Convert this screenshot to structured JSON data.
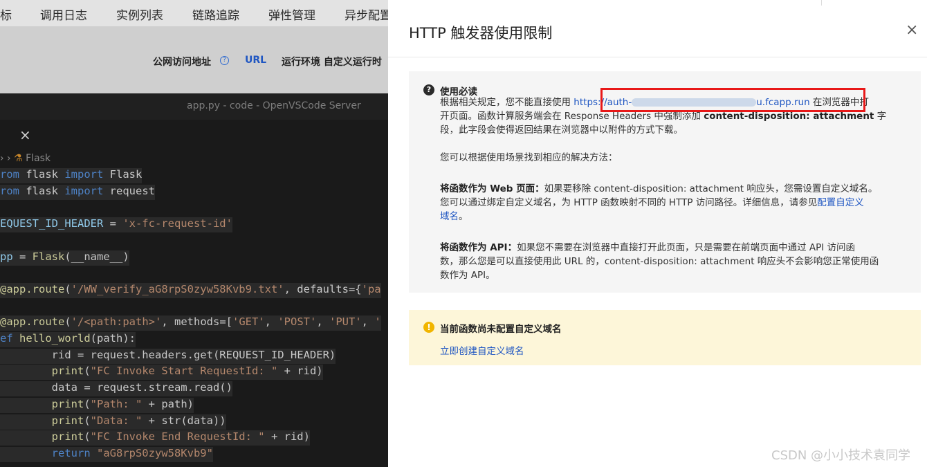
{
  "background": {
    "nav_tabs": [
      "标",
      "调用日志",
      "实例列表",
      "链路追踪",
      "弹性管理",
      "异步配置"
    ],
    "public_url_label": "公网访问地址",
    "help_icon": "?",
    "url_link": "URL",
    "runtime_label": "运行环境 自定义运行时",
    "editor_title": "app.py - code - OpenVSCode Server",
    "tab_close": "×",
    "breadcrumb_file": "Flask",
    "code_lines": [
      [
        "kw:rom ",
        "op:flask ",
        "kw:import ",
        "op:Flask"
      ],
      [
        "kw:rom ",
        "op:flask ",
        "kw:import ",
        "op:request"
      ],
      [],
      [
        "var:EQUEST_ID_HEADER ",
        "op:= ",
        "str:'x-fc-request-id'"
      ],
      [],
      [
        "var:pp ",
        "op:= ",
        "fn:Flask",
        "op:(__name__)"
      ],
      [],
      [
        "fn:@app.route",
        "op:(",
        "str:'/WW_verify_aG8rpS0zyw58Kvb9.txt'",
        "op:, defaults={",
        "str:'pa"
      ],
      [],
      [
        "fn:@app.route",
        "op:(",
        "str:'/<path:path>'",
        "op:, methods=[",
        "str:'GET'",
        "op:, ",
        "str:'POST'",
        "op:, ",
        "str:'PUT'",
        "op:, ",
        "str:'"
      ],
      [
        "kw:ef ",
        "fn:hello_world",
        "op:(path):"
      ],
      [
        "op:        rid = request.headers.get(REQUEST_ID_HEADER)"
      ],
      [
        "op:        ",
        "fn:print",
        "op:(",
        "str:\"FC Invoke Start RequestId: \"",
        "op: + rid)"
      ],
      [
        "op:        data = request.stream.read()"
      ],
      [
        "op:        ",
        "fn:print",
        "op:(",
        "str:\"Path: \"",
        "op: + path)"
      ],
      [
        "op:        ",
        "fn:print",
        "op:(",
        "str:\"Data: \"",
        "op: + str(data))"
      ],
      [
        "op:        ",
        "fn:print",
        "op:(",
        "str:\"FC Invoke End RequestId: \"",
        "op: + rid)"
      ],
      [
        "op:        ",
        "kw:return ",
        "str:\"aG8rpS0zyw58Kvb9\""
      ]
    ]
  },
  "dialog": {
    "title": "HTTP 触发器使用限制",
    "close_icon": "×",
    "notice": {
      "icon": "?",
      "title": "使用必读",
      "line1_prefix": "根据相关规定，您不能直接使用 ",
      "url_start": "https://auth-",
      "url_end": "u.fcapp.run",
      "line1_suffix": " 在浏览器中打",
      "line2_prefix": "开页面。函数计算服务端会在 Response Headers 中强制添加 ",
      "line2_bold": "content-disposition: attachment",
      "line2_suffix": " 字",
      "line3": "段，此字段会使得返回结果在浏览器中以附件的方式下载。",
      "hint": "您可以根据使用场景找到相应的解决方法：",
      "web_bold": "将函数作为 Web 页面：",
      "web_line1": "如果要移除 content-disposition: attachment 响应头，您需设置自定义域名。",
      "web_line2_prefix": "您可以通过绑定自定义域名，为 HTTP 函数映射不同的 HTTP 访问路径。详细信息，请参见",
      "web_link_part1": "配置自定义",
      "web_link_part2": "域名",
      "web_line3_suffix": "。",
      "api_bold": "将函数作为 API：",
      "api_line1": "如果您不需要在浏览器中直接打开此页面，只是需要在前端页面中通过 API 访问函",
      "api_line2": "数，那么您是可以直接使用此 URL 的，content-disposition: attachment 响应头不会影响您正常使用函",
      "api_line3": "数作为 API。"
    },
    "warning": {
      "icon": "!",
      "title": "当前函数尚未配置自定义域名",
      "link": "立即创建自定义域名"
    }
  },
  "watermark": "CSDN @小小技术袁同学",
  "colors": {
    "link": "#1f56c2",
    "highlight_box": "#e81818",
    "warning_bg": "#fdf6d9",
    "warning_icon": "#f1b500",
    "notice_bg": "#f5f5f5",
    "editor_bg": "#1a1a1a"
  }
}
